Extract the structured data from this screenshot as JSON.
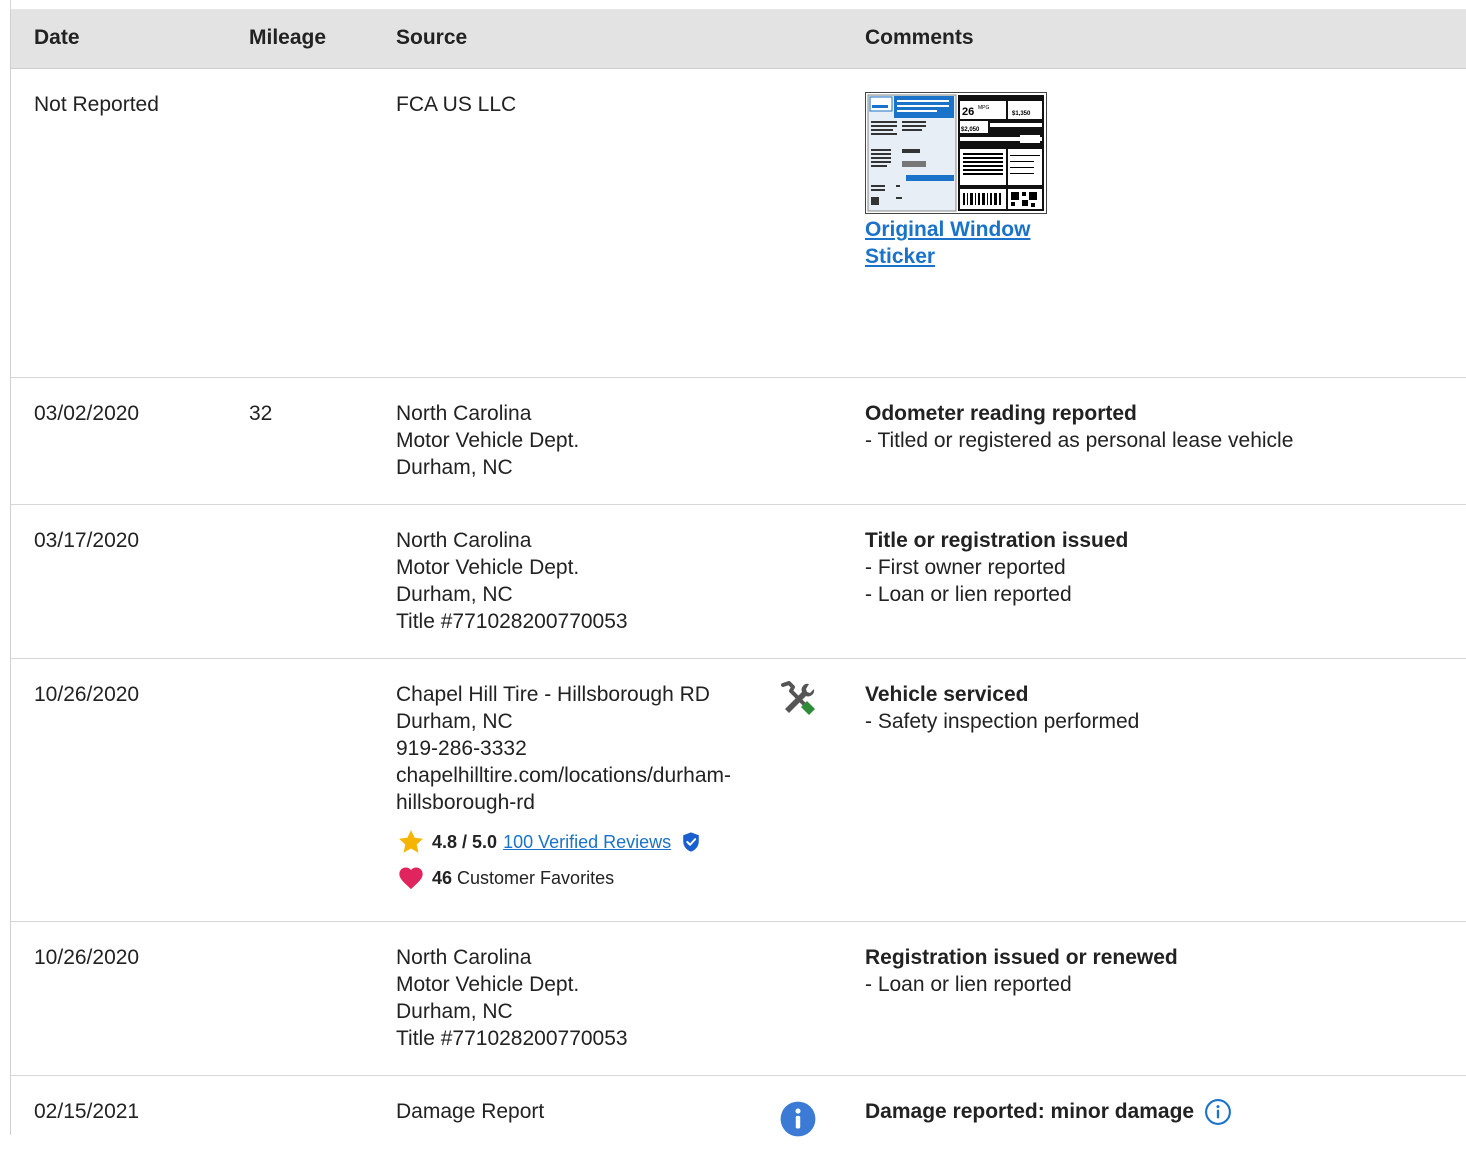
{
  "columns": {
    "date": "Date",
    "mileage": "Mileage",
    "source": "Source",
    "comments": "Comments"
  },
  "rows": [
    {
      "date": "Not Reported",
      "mileage": "",
      "source": [
        "FCA US LLC"
      ],
      "sticker_link": [
        "Original Window",
        "Sticker"
      ]
    },
    {
      "date": "03/02/2020",
      "mileage": "32",
      "source": [
        "North Carolina",
        "Motor Vehicle Dept.",
        "Durham, NC"
      ],
      "comment_title": "Odometer reading reported",
      "comment_items": [
        "Titled or registered as personal lease vehicle"
      ]
    },
    {
      "date": "03/17/2020",
      "mileage": "",
      "source": [
        "North Carolina",
        "Motor Vehicle Dept.",
        "Durham, NC",
        "Title #771028200770053"
      ],
      "comment_title": "Title or registration issued",
      "comment_items": [
        "First owner reported",
        "Loan or lien reported"
      ]
    },
    {
      "date": "10/26/2020",
      "mileage": "",
      "source": [
        "Chapel Hill Tire - Hillsborough RD",
        "Durham, NC",
        "919-286-3332",
        "chapelhilltire.com/locations/durham-",
        "hillsborough-rd"
      ],
      "rating_score": "4.8 / 5.0",
      "reviews_link": "100 Verified Reviews",
      "favorites_count": "46",
      "favorites_label": "Customer Favorites",
      "comment_title": "Vehicle serviced",
      "comment_items": [
        "Safety inspection performed"
      ],
      "source_icon": "service-tools-icon"
    },
    {
      "date": "10/26/2020",
      "mileage": "",
      "source": [
        "North Carolina",
        "Motor Vehicle Dept.",
        "Durham, NC",
        "Title #771028200770053"
      ],
      "comment_title": "Registration issued or renewed",
      "comment_items": [
        "Loan or lien reported"
      ]
    },
    {
      "date": "02/15/2021",
      "mileage": "",
      "source": [
        "Damage Report"
      ],
      "comment_title": "Damage reported: minor damage",
      "source_icon": "info-icon"
    }
  ],
  "colors": {
    "header_bg": "#e3e3e3",
    "link": "#1a73c9",
    "star": "#f5b400",
    "heart": "#e0245e",
    "verified": "#1a5fd0",
    "tools_green": "#2e8b3a",
    "info_blue": "#3b7bd6"
  }
}
